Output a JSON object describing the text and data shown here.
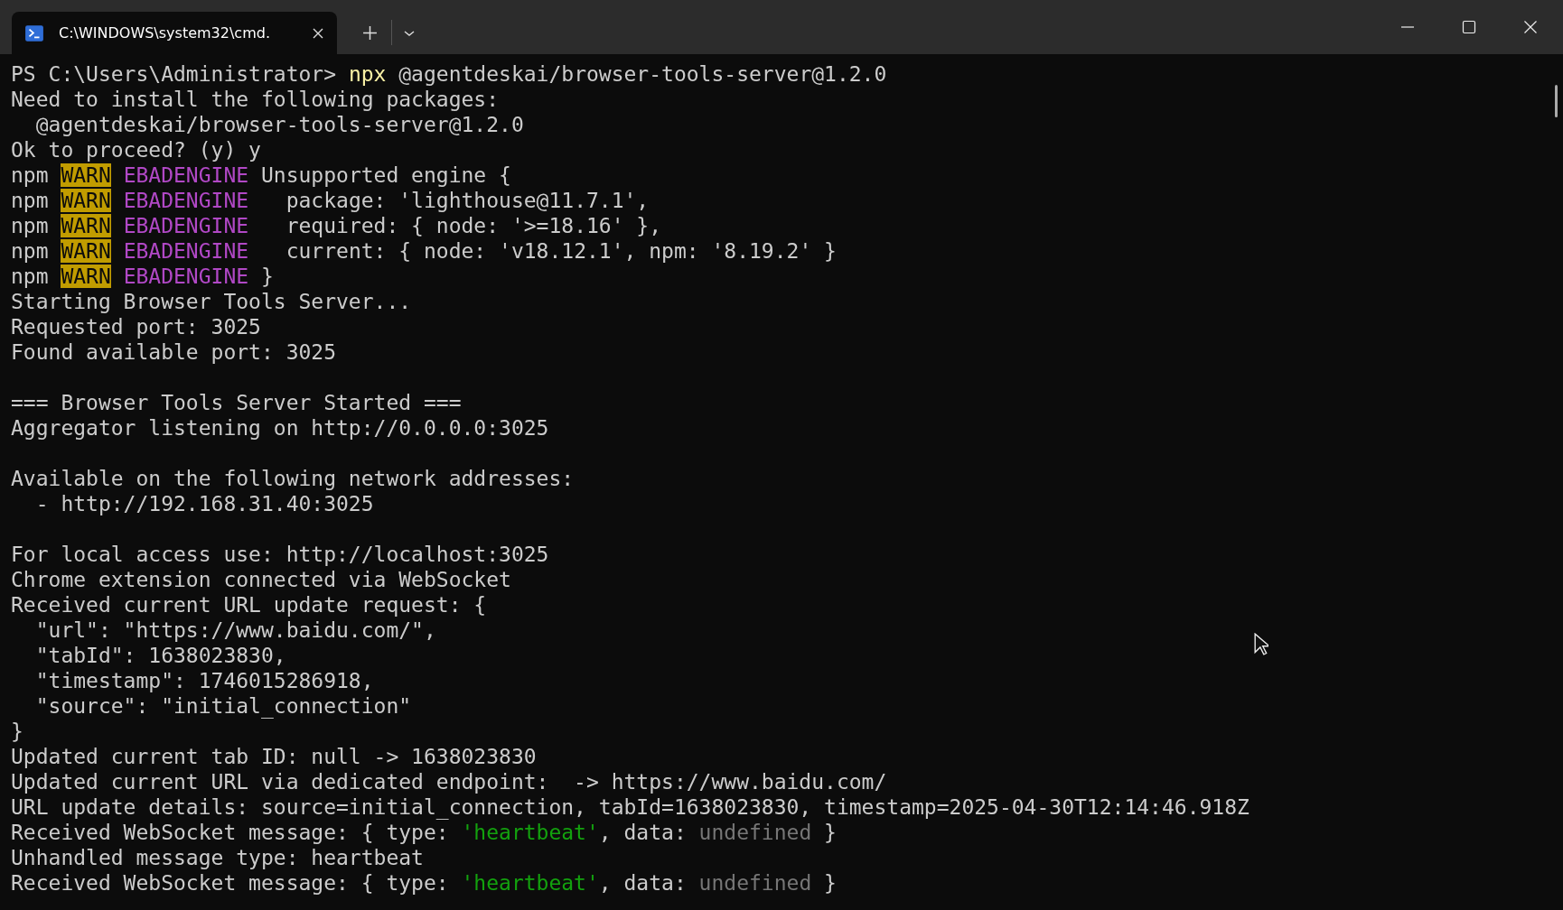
{
  "tabs": [
    {
      "title": "C:\\WINDOWS\\system32\\cmd.",
      "selected": true
    }
  ],
  "terminal": {
    "lines": [
      {
        "kind": "text",
        "segments": [
          {
            "kind": "plain",
            "text": "PS C:\\Users\\Administrator> "
          },
          {
            "kind": "command",
            "text": "npx"
          },
          {
            "kind": "plain",
            "text": " @agentdeskai/browser-tools-server@1.2.0"
          }
        ]
      },
      {
        "kind": "text",
        "segments": [
          {
            "kind": "plain",
            "text": "Need to install the following packages:"
          }
        ]
      },
      {
        "kind": "text",
        "segments": [
          {
            "kind": "plain",
            "text": "  @agentdeskai/browser-tools-server@1.2.0"
          }
        ]
      },
      {
        "kind": "text",
        "segments": [
          {
            "kind": "plain",
            "text": "Ok to proceed? (y) y"
          }
        ]
      },
      {
        "kind": "text",
        "segments": [
          {
            "kind": "plain",
            "text": "npm "
          },
          {
            "kind": "warn",
            "text": "WARN"
          },
          {
            "kind": "code",
            "text": " EBADENGINE"
          },
          {
            "kind": "plain",
            "text": " Unsupported engine {"
          }
        ]
      },
      {
        "kind": "text",
        "segments": [
          {
            "kind": "plain",
            "text": "npm "
          },
          {
            "kind": "warn",
            "text": "WARN"
          },
          {
            "kind": "code",
            "text": " EBADENGINE"
          },
          {
            "kind": "plain",
            "text": "   package: 'lighthouse@11.7.1',"
          }
        ]
      },
      {
        "kind": "text",
        "segments": [
          {
            "kind": "plain",
            "text": "npm "
          },
          {
            "kind": "warn",
            "text": "WARN"
          },
          {
            "kind": "code",
            "text": " EBADENGINE"
          },
          {
            "kind": "plain",
            "text": "   required: { node: '>=18.16' },"
          }
        ]
      },
      {
        "kind": "text",
        "segments": [
          {
            "kind": "plain",
            "text": "npm "
          },
          {
            "kind": "warn",
            "text": "WARN"
          },
          {
            "kind": "code",
            "text": " EBADENGINE"
          },
          {
            "kind": "plain",
            "text": "   current: { node: 'v18.12.1', npm: '8.19.2' }"
          }
        ]
      },
      {
        "kind": "text",
        "segments": [
          {
            "kind": "plain",
            "text": "npm "
          },
          {
            "kind": "warn",
            "text": "WARN"
          },
          {
            "kind": "code",
            "text": " EBADENGINE"
          },
          {
            "kind": "plain",
            "text": " }"
          }
        ]
      },
      {
        "kind": "text",
        "segments": [
          {
            "kind": "plain",
            "text": "Starting Browser Tools Server..."
          }
        ]
      },
      {
        "kind": "text",
        "segments": [
          {
            "kind": "plain",
            "text": "Requested port: 3025"
          }
        ]
      },
      {
        "kind": "text",
        "segments": [
          {
            "kind": "plain",
            "text": "Found available port: 3025"
          }
        ]
      },
      {
        "kind": "blank"
      },
      {
        "kind": "text",
        "segments": [
          {
            "kind": "plain",
            "text": "=== Browser Tools Server Started ==="
          }
        ]
      },
      {
        "kind": "text",
        "segments": [
          {
            "kind": "plain",
            "text": "Aggregator listening on http://0.0.0.0:3025"
          }
        ]
      },
      {
        "kind": "blank"
      },
      {
        "kind": "text",
        "segments": [
          {
            "kind": "plain",
            "text": "Available on the following network addresses:"
          }
        ]
      },
      {
        "kind": "text",
        "segments": [
          {
            "kind": "plain",
            "text": "  - http://192.168.31.40:3025"
          }
        ]
      },
      {
        "kind": "blank"
      },
      {
        "kind": "text",
        "segments": [
          {
            "kind": "plain",
            "text": "For local access use: http://localhost:3025"
          }
        ]
      },
      {
        "kind": "text",
        "segments": [
          {
            "kind": "plain",
            "text": "Chrome extension connected via WebSocket"
          }
        ]
      },
      {
        "kind": "text",
        "segments": [
          {
            "kind": "plain",
            "text": "Received current URL update request: {"
          }
        ]
      },
      {
        "kind": "text",
        "segments": [
          {
            "kind": "plain",
            "text": "  \"url\": \"https://www.baidu.com/\","
          }
        ]
      },
      {
        "kind": "text",
        "segments": [
          {
            "kind": "plain",
            "text": "  \"tabId\": 1638023830,"
          }
        ]
      },
      {
        "kind": "text",
        "segments": [
          {
            "kind": "plain",
            "text": "  \"timestamp\": 1746015286918,"
          }
        ]
      },
      {
        "kind": "text",
        "segments": [
          {
            "kind": "plain",
            "text": "  \"source\": \"initial_connection\""
          }
        ]
      },
      {
        "kind": "text",
        "segments": [
          {
            "kind": "plain",
            "text": "}"
          }
        ]
      },
      {
        "kind": "text",
        "segments": [
          {
            "kind": "plain",
            "text": "Updated current tab ID: null -> 1638023830"
          }
        ]
      },
      {
        "kind": "text",
        "segments": [
          {
            "kind": "plain",
            "text": "Updated current URL via dedicated endpoint:  -> https://www.baidu.com/"
          }
        ]
      },
      {
        "kind": "text",
        "segments": [
          {
            "kind": "plain",
            "text": "URL update details: source=initial_connection, tabId=1638023830, timestamp=2025-04-30T12:14:46.918Z"
          }
        ]
      },
      {
        "kind": "text",
        "segments": [
          {
            "kind": "plain",
            "text": "Received WebSocket message: { type: "
          },
          {
            "kind": "string",
            "text": "'heartbeat'"
          },
          {
            "kind": "plain",
            "text": ", data: "
          },
          {
            "kind": "muted",
            "text": "undefined"
          },
          {
            "kind": "plain",
            "text": " }"
          }
        ]
      },
      {
        "kind": "text",
        "segments": [
          {
            "kind": "plain",
            "text": "Unhandled message type: heartbeat"
          }
        ]
      },
      {
        "kind": "text",
        "segments": [
          {
            "kind": "plain",
            "text": "Received WebSocket message: { type: "
          },
          {
            "kind": "string",
            "text": "'heartbeat'"
          },
          {
            "kind": "plain",
            "text": ", data: "
          },
          {
            "kind": "muted",
            "text": "undefined"
          },
          {
            "kind": "plain",
            "text": " }"
          }
        ]
      }
    ]
  }
}
